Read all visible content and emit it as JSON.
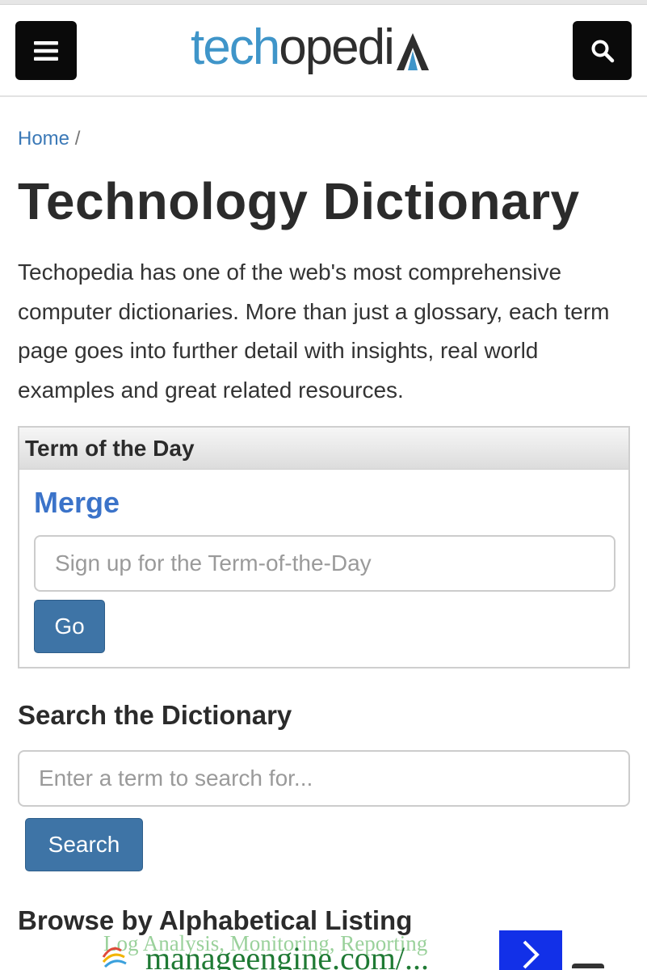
{
  "header": {
    "logo_tech": "tech",
    "logo_rest": "oped",
    "menu_icon": "hamburger-icon",
    "search_icon": "search-icon"
  },
  "breadcrumb": {
    "home": "Home",
    "separator": "/"
  },
  "page": {
    "title": "Technology Dictionary",
    "intro": "Techopedia has one of the web's most comprehensive computer dictionaries. More than just a glossary, each term page goes into further detail with insights, real world examples and great related resources."
  },
  "term_of_the_day": {
    "heading": "Term of the Day",
    "term": "Merge",
    "signup_placeholder": "Sign up for the Term-of-the-Day",
    "go_label": "Go"
  },
  "search": {
    "heading": "Search the Dictionary",
    "placeholder": "Enter a term to search for...",
    "button_label": "Search"
  },
  "browse": {
    "heading": "Browse by Alphabetical Listing"
  },
  "ad": {
    "tagline": "Log Analysis, Monitoring, Reporting",
    "url": "manageengine.com/...",
    "arrow_icon": "chevron-right-icon"
  },
  "colors": {
    "accent_blue": "#3b73c9",
    "button_blue": "#3e74a6",
    "logo_blue": "#3f95c9",
    "ad_arrow_blue": "#1230e8"
  }
}
